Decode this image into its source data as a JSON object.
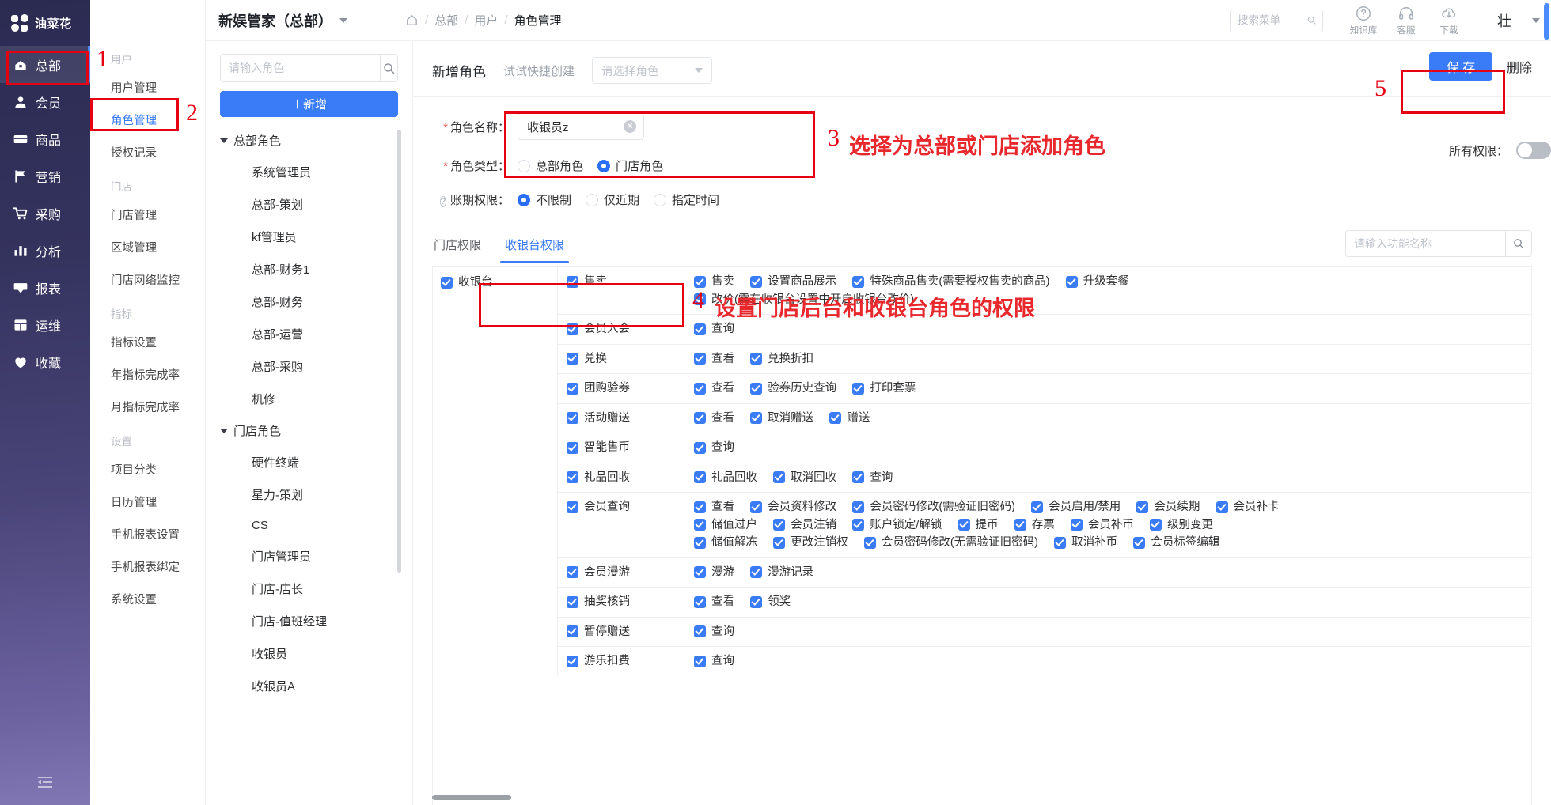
{
  "rail": {
    "logo_text": "油菜花",
    "items": [
      {
        "label": "总部",
        "icon": "building-icon",
        "active": true
      },
      {
        "label": "会员",
        "icon": "user-icon",
        "active": false
      },
      {
        "label": "商品",
        "icon": "card-icon",
        "active": false
      },
      {
        "label": "营销",
        "icon": "flag-icon",
        "active": false
      },
      {
        "label": "采购",
        "icon": "cart-icon",
        "active": false
      },
      {
        "label": "分析",
        "icon": "chart-icon",
        "active": false
      },
      {
        "label": "报表",
        "icon": "report-icon",
        "active": false
      },
      {
        "label": "运维",
        "icon": "layout-icon",
        "active": false
      },
      {
        "label": "收藏",
        "icon": "heart-icon",
        "active": false
      }
    ],
    "collapse_icon": "collapse-menu-icon"
  },
  "subnav": {
    "sections": [
      {
        "group": "用户",
        "items": [
          {
            "label": "用户管理",
            "active": false
          },
          {
            "label": "角色管理",
            "active": true
          },
          {
            "label": "授权记录",
            "active": false
          }
        ]
      },
      {
        "group": "门店",
        "items": [
          {
            "label": "门店管理",
            "active": false
          },
          {
            "label": "区域管理",
            "active": false
          },
          {
            "label": "门店网络监控",
            "active": false
          }
        ]
      },
      {
        "group": "指标",
        "items": [
          {
            "label": "指标设置",
            "active": false
          },
          {
            "label": "年指标完成率",
            "active": false
          },
          {
            "label": "月指标完成率",
            "active": false
          }
        ]
      },
      {
        "group": "设置",
        "items": [
          {
            "label": "项目分类",
            "active": false
          },
          {
            "label": "日历管理",
            "active": false
          },
          {
            "label": "手机报表设置",
            "active": false
          },
          {
            "label": "手机报表绑定",
            "active": false
          },
          {
            "label": "系统设置",
            "active": false
          }
        ]
      }
    ]
  },
  "topbar": {
    "app_title": "新娱管家（总部）",
    "breadcrumb": [
      "总部",
      "用户",
      "角色管理"
    ],
    "home_icon": "home-icon",
    "search_placeholder": "搜索菜单",
    "search_value": "",
    "tools": [
      {
        "label": "知识库",
        "icon": "question-circle-icon"
      },
      {
        "label": "客服",
        "icon": "headset-icon"
      },
      {
        "label": "下载",
        "icon": "cloud-download-icon"
      }
    ],
    "user_name": "壮"
  },
  "role_list": {
    "search_placeholder": "请输入角色",
    "search_value": "",
    "search_icon": "search-icon",
    "add_button": "＋新增",
    "groups": [
      {
        "name": "总部角色",
        "expanded": true,
        "roles": [
          "系统管理员",
          "总部-策划",
          "kf管理员",
          "总部-财务1",
          "总部-财务",
          "总部-运营",
          "总部-采购",
          "机修"
        ]
      },
      {
        "name": "门店角色",
        "expanded": true,
        "roles": [
          "硬件终端",
          "星力-策划",
          "CS",
          "门店管理员",
          "门店-店长",
          "门店-值班经理",
          "收银员",
          "收银员A"
        ]
      }
    ]
  },
  "form": {
    "title": "新增角色",
    "quick_label": "试试快捷创建",
    "quick_placeholder": "请选择角色",
    "role_name_label": "角色名称：",
    "role_name_value": "收银员z",
    "role_type_label": "角色类型：",
    "role_type_options": [
      {
        "label": "总部角色",
        "selected": false
      },
      {
        "label": "门店角色",
        "selected": true
      }
    ],
    "period_label": "账期权限：",
    "period_options": [
      {
        "label": "不限制",
        "selected": true
      },
      {
        "label": "仅近期",
        "selected": false
      },
      {
        "label": "指定时间",
        "selected": false
      }
    ],
    "all_perm_label": "所有权限：",
    "all_perm_on": false
  },
  "actions": {
    "save_label": "保 存",
    "delete_label": "删除"
  },
  "perm_tabs": [
    {
      "label": "门店权限",
      "active": false
    },
    {
      "label": "收银台权限",
      "active": true
    }
  ],
  "func_search": {
    "placeholder": "请输入功能名称",
    "value": "",
    "icon": "search-icon"
  },
  "perm_table": {
    "root": "收银台",
    "rows": [
      {
        "module": "售卖",
        "perms": [
          "售卖",
          "设置商品展示",
          "特殊商品售卖(需要授权售卖的商品)",
          "升级套餐",
          "改价(需在收银台设置中开启收银台改价)"
        ]
      },
      {
        "module": "会员入会",
        "perms": [
          "查询"
        ]
      },
      {
        "module": "兑换",
        "perms": [
          "查看",
          "兑换折扣"
        ]
      },
      {
        "module": "团购验券",
        "perms": [
          "查看",
          "验券历史查询",
          "打印套票"
        ]
      },
      {
        "module": "活动赠送",
        "perms": [
          "查看",
          "取消赠送",
          "赠送"
        ]
      },
      {
        "module": "智能售币",
        "perms": [
          "查询"
        ]
      },
      {
        "module": "礼品回收",
        "perms": [
          "礼品回收",
          "取消回收",
          "查询"
        ]
      },
      {
        "module": "会员查询",
        "perms": [
          "查看",
          "会员资料修改",
          "会员密码修改(需验证旧密码)",
          "会员启用/禁用",
          "会员续期",
          "会员补卡",
          "储值过户",
          "会员注销",
          "账户锁定/解锁",
          "提币",
          "存票",
          "会员补币",
          "级别变更",
          "储值解冻",
          "更改注销权",
          "会员密码修改(无需验证旧密码)",
          "取消补币",
          "会员标签编辑"
        ]
      },
      {
        "module": "会员漫游",
        "perms": [
          "漫游",
          "漫游记录"
        ]
      },
      {
        "module": "抽奖核销",
        "perms": [
          "查看",
          "领奖"
        ]
      },
      {
        "module": "暂停赠送",
        "perms": [
          "查询"
        ]
      },
      {
        "module": "游乐扣费",
        "perms": [
          "查询"
        ]
      }
    ]
  },
  "annotations": [
    {
      "num": "1",
      "text": ""
    },
    {
      "num": "2",
      "text": ""
    },
    {
      "num": "3",
      "text": "选择为总部或门店添加角色"
    },
    {
      "num": "4",
      "text": "设置门店后台和收银台角色的权限"
    },
    {
      "num": "5",
      "text": ""
    }
  ]
}
